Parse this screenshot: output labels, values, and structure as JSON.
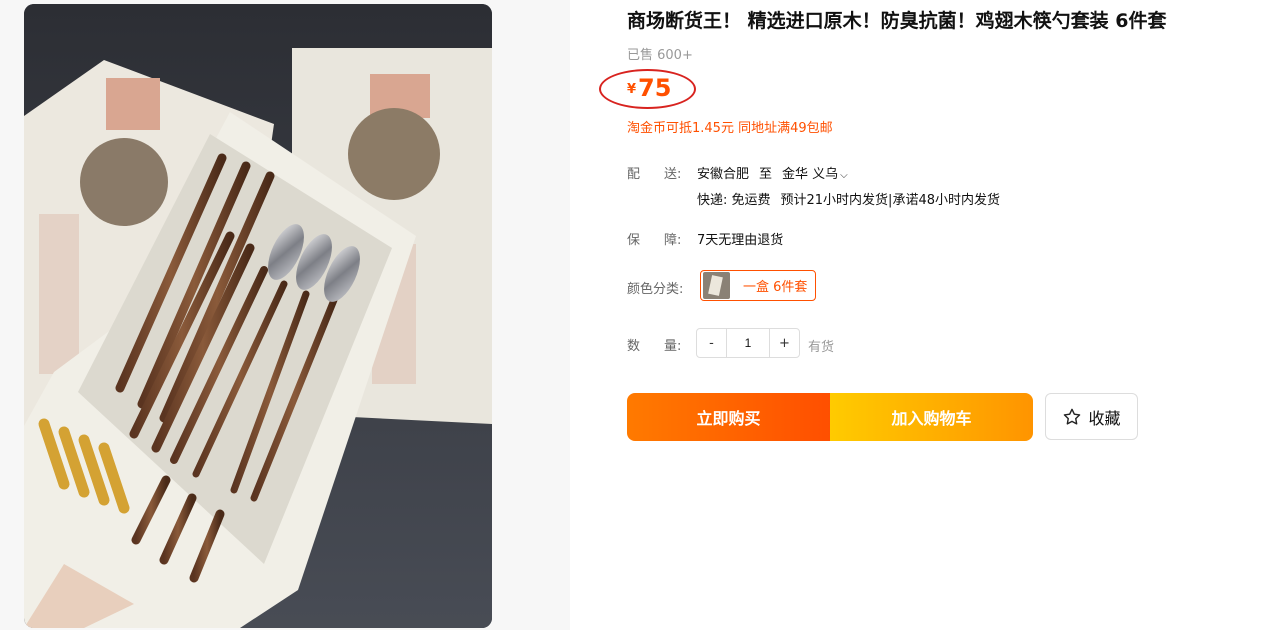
{
  "product": {
    "title": "商场断货王！ 精选进口原木！防臭抗菌！鸡翅木筷勺套装 6件套",
    "sold": "已售 600+",
    "currency": "¥",
    "price": "75",
    "promo": "淘金币可抵1.45元 同地址满49包邮"
  },
  "delivery": {
    "label_a": "配",
    "label_b": "送:",
    "from": "安徽合肥",
    "to_word": "至",
    "destination": "金华 义乌",
    "dropdown_icon": "chevron-down-icon",
    "shipping": "快递: 免运费",
    "eta": "预计21小时内发货|承诺48小时内发货"
  },
  "guarantee": {
    "label_a": "保",
    "label_b": "障:",
    "value": "7天无理由退货"
  },
  "color": {
    "label": "颜色分类:",
    "option": "一盒 6件套"
  },
  "quantity": {
    "label_a": "数",
    "label_b": "量:",
    "minus": "-",
    "value": "1",
    "plus": "+",
    "stock": "有货"
  },
  "actions": {
    "buy": "立即购买",
    "cart": "加入购物车",
    "favorite": "收藏",
    "favorite_icon": "star-outline-icon"
  },
  "colors": {
    "accent": "#ff5000",
    "annotation_circle": "#d8231f"
  }
}
